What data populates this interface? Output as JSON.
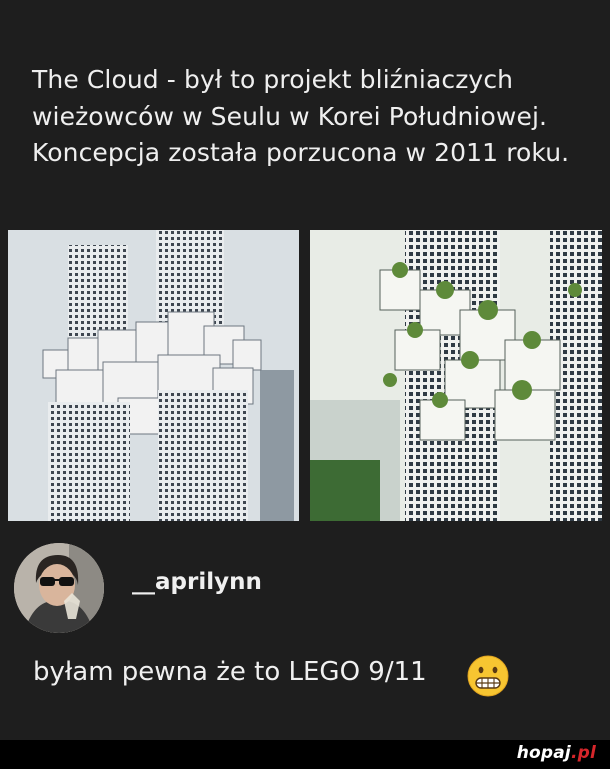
{
  "post": {
    "text": "The Cloud - był to projekt bliźniaczych wieżowców w Seulu w Korei Południowej. Koncepcja została porzucona w 2011 roku.",
    "images": [
      {
        "icon": "the-cloud-towers-render-photo"
      },
      {
        "icon": "the-cloud-green-terraces-render-photo"
      }
    ]
  },
  "comment": {
    "username": "__aprilynn",
    "avatar_icon": "user-avatar-photo",
    "text": "byłam pewna że to LEGO 9/11",
    "emoji_icon": "grimacing-face-emoji"
  },
  "footer": {
    "logo_main": "hopaj",
    "logo_suffix": ".pl",
    "brand_accent": "#d6262b"
  },
  "colors": {
    "background": "#1e1e1e",
    "text": "#f0f0f0",
    "footer_bg": "#000000"
  }
}
